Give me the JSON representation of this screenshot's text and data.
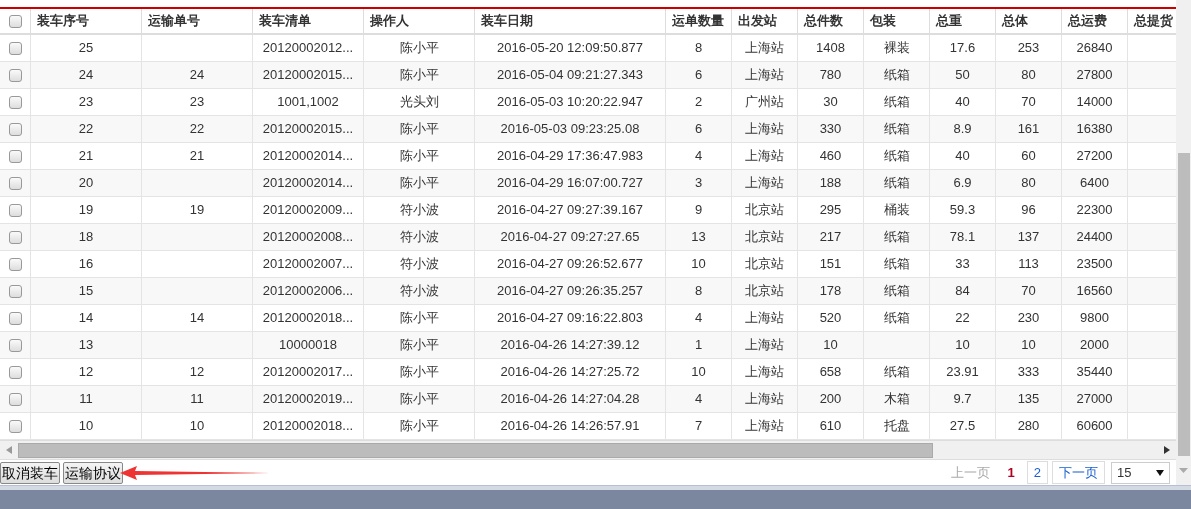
{
  "table": {
    "header_checked": false,
    "columns": [
      "装车序号",
      "运输单号",
      "装车清单",
      "操作人",
      "装车日期",
      "运单数量",
      "出发站",
      "总件数",
      "包装",
      "总重",
      "总体",
      "总运费",
      "总提货"
    ],
    "rows": [
      {
        "checked": false,
        "cells": [
          "25",
          "",
          "20120002012...",
          "陈小平",
          "2016-05-20 12:09:50.877",
          "8",
          "上海站",
          "1408",
          "裸装",
          "17.6",
          "253",
          "26840"
        ]
      },
      {
        "checked": false,
        "cells": [
          "24",
          "24",
          "20120002015...",
          "陈小平",
          "2016-05-04 09:21:27.343",
          "6",
          "上海站",
          "780",
          "纸箱",
          "50",
          "80",
          "27800"
        ]
      },
      {
        "checked": false,
        "cells": [
          "23",
          "23",
          "1001,1002",
          "光头刘",
          "2016-05-03 10:20:22.947",
          "2",
          "广州站",
          "30",
          "纸箱",
          "40",
          "70",
          "14000"
        ]
      },
      {
        "checked": false,
        "cells": [
          "22",
          "22",
          "20120002015...",
          "陈小平",
          "2016-05-03 09:23:25.08",
          "6",
          "上海站",
          "330",
          "纸箱",
          "8.9",
          "161",
          "16380"
        ]
      },
      {
        "checked": false,
        "cells": [
          "21",
          "21",
          "20120002014...",
          "陈小平",
          "2016-04-29 17:36:47.983",
          "4",
          "上海站",
          "460",
          "纸箱",
          "40",
          "60",
          "27200"
        ]
      },
      {
        "checked": false,
        "cells": [
          "20",
          "",
          "20120002014...",
          "陈小平",
          "2016-04-29 16:07:00.727",
          "3",
          "上海站",
          "188",
          "纸箱",
          "6.9",
          "80",
          "6400"
        ]
      },
      {
        "checked": false,
        "cells": [
          "19",
          "19",
          "20120002009...",
          "符小波",
          "2016-04-27 09:27:39.167",
          "9",
          "北京站",
          "295",
          "桶装",
          "59.3",
          "96",
          "22300"
        ]
      },
      {
        "checked": false,
        "cells": [
          "18",
          "",
          "20120002008...",
          "符小波",
          "2016-04-27 09:27:27.65",
          "13",
          "北京站",
          "217",
          "纸箱",
          "78.1",
          "137",
          "24400"
        ]
      },
      {
        "checked": false,
        "cells": [
          "16",
          "",
          "20120002007...",
          "符小波",
          "2016-04-27 09:26:52.677",
          "10",
          "北京站",
          "151",
          "纸箱",
          "33",
          "113",
          "23500"
        ]
      },
      {
        "checked": false,
        "cells": [
          "15",
          "",
          "20120002006...",
          "符小波",
          "2016-04-27 09:26:35.257",
          "8",
          "北京站",
          "178",
          "纸箱",
          "84",
          "70",
          "16560"
        ]
      },
      {
        "checked": false,
        "cells": [
          "14",
          "14",
          "20120002018...",
          "陈小平",
          "2016-04-27 09:16:22.803",
          "4",
          "上海站",
          "520",
          "纸箱",
          "22",
          "230",
          "9800"
        ]
      },
      {
        "checked": false,
        "cells": [
          "13",
          "",
          "10000018",
          "陈小平",
          "2016-04-26 14:27:39.12",
          "1",
          "上海站",
          "10",
          "",
          "10",
          "10",
          "2000"
        ]
      },
      {
        "checked": false,
        "cells": [
          "12",
          "12",
          "20120002017...",
          "陈小平",
          "2016-04-26 14:27:25.72",
          "10",
          "上海站",
          "658",
          "纸箱",
          "23.91",
          "333",
          "35440"
        ]
      },
      {
        "checked": false,
        "cells": [
          "11",
          "11",
          "20120002019...",
          "陈小平",
          "2016-04-26 14:27:04.28",
          "4",
          "上海站",
          "200",
          "木箱",
          "9.7",
          "135",
          "27000"
        ]
      },
      {
        "checked": false,
        "cells": [
          "10",
          "10",
          "20120002018...",
          "陈小平",
          "2016-04-26 14:26:57.91",
          "7",
          "上海站",
          "610",
          "托盘",
          "27.5",
          "280",
          "60600"
        ]
      }
    ]
  },
  "toolbar": {
    "buttons": [
      "取消装车",
      "运输协议"
    ]
  },
  "pagination": {
    "prev": {
      "label": "上一页",
      "disabled": true
    },
    "pages": [
      {
        "label": "1",
        "selected": true
      },
      {
        "label": "2",
        "selected": false
      }
    ],
    "next": {
      "label": "下一页",
      "disabled": false
    },
    "page_size": "15"
  }
}
